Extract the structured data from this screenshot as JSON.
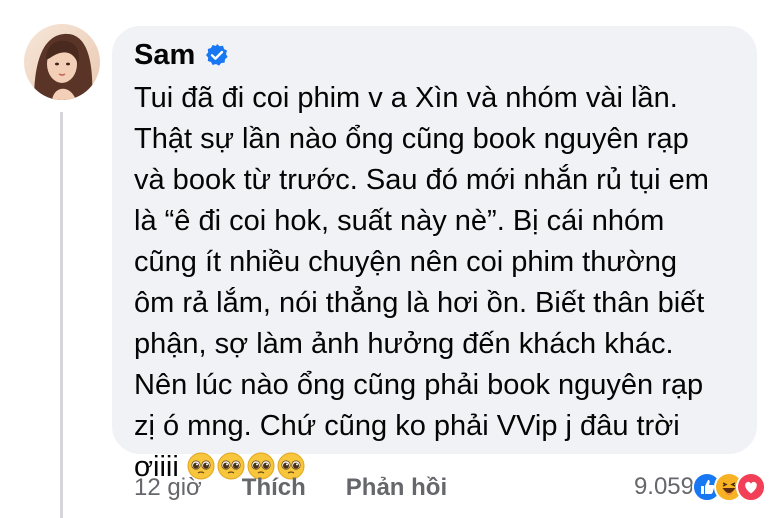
{
  "comment": {
    "author": "Sam",
    "verified_icon": "verified-badge-icon",
    "lines": [
      "Tui đã đi coi phim v a Xìn và nhóm vài lần.",
      "Thật sự lần nào ổng cũng book nguyên rạp",
      "và book từ trước. Sau đó mới nhắn rủ tụi em",
      "là “ê đi coi hok, suất này nè”. Bị cái nhóm",
      "cũng ít nhiều chuyện nên coi phim thường",
      "ôm rả lắm, nói thẳng là hơi ồn. Biết thân biết",
      "phận, sợ làm ảnh hưởng đến khách khác.",
      "Nên lúc nào ổng cũng phải book nguyên rạp",
      "zị ó mng. Chứ cũng ko phải VVip j đâu trời"
    ],
    "last_line_text": "ơiiii",
    "last_line_emojis": [
      "pleading-face-emoji",
      "pleading-face-emoji",
      "pleading-face-emoji",
      "pleading-face-emoji"
    ]
  },
  "actions": {
    "time": "12 giờ",
    "like": "Thích",
    "reply": "Phản hồi"
  },
  "reactions": {
    "count": "9.059",
    "icons": [
      "like-reaction-icon",
      "haha-reaction-icon",
      "love-reaction-icon"
    ]
  },
  "colors": {
    "bubble": "#f0f2f5",
    "verified": "#1877f2",
    "meta_text": "#65676b",
    "like": "#1877f2",
    "love": "#f33e58",
    "haha": "#f7b125"
  }
}
